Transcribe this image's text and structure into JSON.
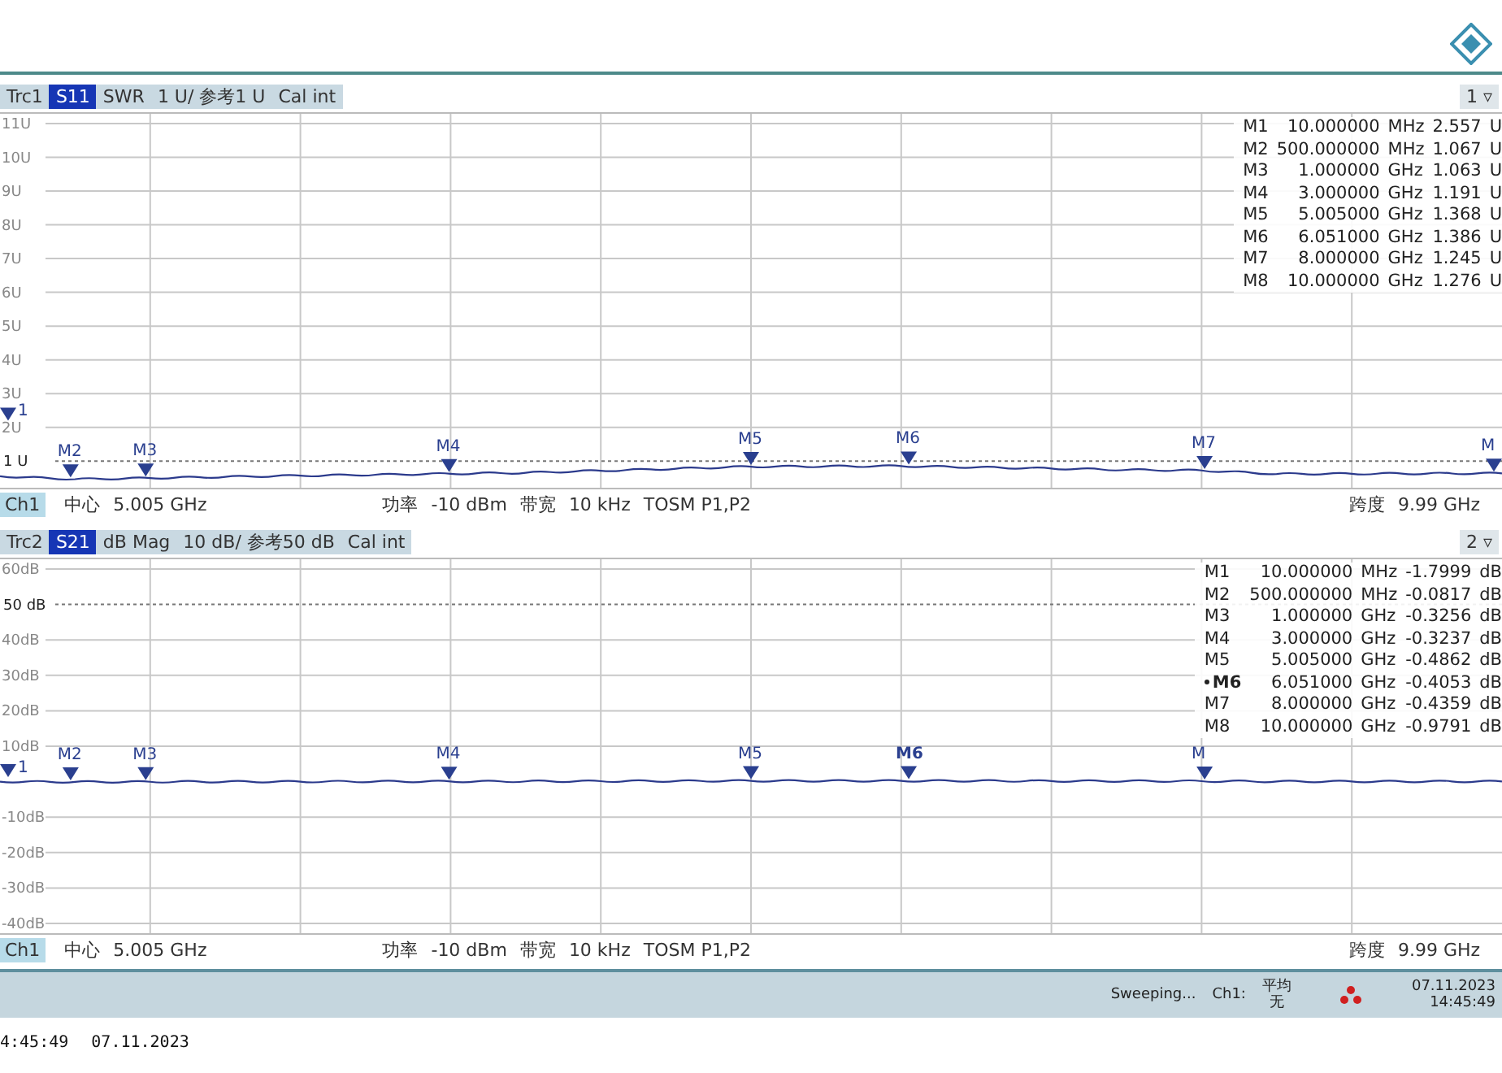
{
  "traces": [
    {
      "header": {
        "trace": "Trc1",
        "param": "S11",
        "format": "SWR",
        "scale": "1 U/ 参考1 U",
        "cal": "Cal int",
        "window": "1 ▿"
      },
      "y_axis": [
        {
          "label": "11U",
          "kind": "tick"
        },
        {
          "label": "10U",
          "kind": "tick"
        },
        {
          "label": "9U",
          "kind": "tick"
        },
        {
          "label": "8U",
          "kind": "tick"
        },
        {
          "label": "7U",
          "kind": "tick"
        },
        {
          "label": "6U",
          "kind": "tick"
        },
        {
          "label": "5U",
          "kind": "tick"
        },
        {
          "label": "4U",
          "kind": "tick"
        },
        {
          "label": "3U",
          "kind": "tick"
        },
        {
          "label": "2U",
          "kind": "tick"
        },
        {
          "label": "1 U",
          "kind": "reference"
        }
      ],
      "plot_markers": [
        {
          "label": "1",
          "selected": false
        },
        {
          "label": "M2",
          "selected": false
        },
        {
          "label": "M3",
          "selected": false
        },
        {
          "label": "M4",
          "selected": false
        },
        {
          "label": "M5",
          "selected": false
        },
        {
          "label": "M6",
          "selected": false
        },
        {
          "label": "M7",
          "selected": false
        },
        {
          "label": "M",
          "selected": false
        }
      ],
      "markers": [
        {
          "name": "M1",
          "freq": "10.000000",
          "unit": "MHz",
          "value": "2.557",
          "vunit": "U",
          "selected": false
        },
        {
          "name": "M2",
          "freq": "500.000000",
          "unit": "MHz",
          "value": "1.067",
          "vunit": "U",
          "selected": false
        },
        {
          "name": "M3",
          "freq": "1.000000",
          "unit": "GHz",
          "value": "1.063",
          "vunit": "U",
          "selected": false
        },
        {
          "name": "M4",
          "freq": "3.000000",
          "unit": "GHz",
          "value": "1.191",
          "vunit": "U",
          "selected": false
        },
        {
          "name": "M5",
          "freq": "5.005000",
          "unit": "GHz",
          "value": "1.368",
          "vunit": "U",
          "selected": false
        },
        {
          "name": "M6",
          "freq": "6.051000",
          "unit": "GHz",
          "value": "1.386",
          "vunit": "U",
          "selected": false
        },
        {
          "name": "M7",
          "freq": "8.000000",
          "unit": "GHz",
          "value": "1.245",
          "vunit": "U",
          "selected": false
        },
        {
          "name": "M8",
          "freq": "10.000000",
          "unit": "GHz",
          "value": "1.276",
          "vunit": "U",
          "selected": false
        }
      ],
      "channel": {
        "ch": "Ch1",
        "center_label": "中心",
        "center": "5.005 GHz",
        "power_label": "功率",
        "power": "-10 dBm",
        "bw_label": "带宽",
        "bw": "10 kHz",
        "cal": "TOSM P1,P2",
        "span_label": "跨度",
        "span": "9.99 GHz"
      }
    },
    {
      "header": {
        "trace": "Trc2",
        "param": "S21",
        "format": "dB Mag",
        "scale": "10 dB/ 参考50 dB",
        "cal": "Cal int",
        "window": "2 ▿"
      },
      "y_axis": [
        {
          "label": "60dB",
          "kind": "tick"
        },
        {
          "label": "50 dB",
          "kind": "reference"
        },
        {
          "label": "40dB",
          "kind": "tick"
        },
        {
          "label": "30dB",
          "kind": "tick"
        },
        {
          "label": "20dB",
          "kind": "tick"
        },
        {
          "label": "10dB",
          "kind": "tick"
        },
        {
          "label": "-10dB",
          "kind": "tick"
        },
        {
          "label": "-20dB",
          "kind": "tick"
        },
        {
          "label": "-30dB",
          "kind": "tick"
        },
        {
          "label": "-40dB",
          "kind": "tick"
        }
      ],
      "plot_markers": [
        {
          "label": "1",
          "selected": false
        },
        {
          "label": "M2",
          "selected": false
        },
        {
          "label": "M3",
          "selected": false
        },
        {
          "label": "M4",
          "selected": false
        },
        {
          "label": "M5",
          "selected": false
        },
        {
          "label": "M6",
          "selected": true
        },
        {
          "label": "M",
          "selected": false
        }
      ],
      "markers": [
        {
          "name": "M1",
          "freq": "10.000000",
          "unit": "MHz",
          "value": "-1.7999",
          "vunit": "dB",
          "selected": false
        },
        {
          "name": "M2",
          "freq": "500.000000",
          "unit": "MHz",
          "value": "-0.0817",
          "vunit": "dB",
          "selected": false
        },
        {
          "name": "M3",
          "freq": "1.000000",
          "unit": "GHz",
          "value": "-0.3256",
          "vunit": "dB",
          "selected": false
        },
        {
          "name": "M4",
          "freq": "3.000000",
          "unit": "GHz",
          "value": "-0.3237",
          "vunit": "dB",
          "selected": false
        },
        {
          "name": "M5",
          "freq": "5.005000",
          "unit": "GHz",
          "value": "-0.4862",
          "vunit": "dB",
          "selected": false
        },
        {
          "name": "M6",
          "freq": "6.051000",
          "unit": "GHz",
          "value": "-0.4053",
          "vunit": "dB",
          "selected": true
        },
        {
          "name": "M7",
          "freq": "8.000000",
          "unit": "GHz",
          "value": "-0.4359",
          "vunit": "dB",
          "selected": false
        },
        {
          "name": "M8",
          "freq": "10.000000",
          "unit": "GHz",
          "value": "-0.9791",
          "vunit": "dB",
          "selected": false
        }
      ],
      "channel": {
        "ch": "Ch1",
        "center_label": "中心",
        "center": "5.005 GHz",
        "power_label": "功率",
        "power": "-10 dBm",
        "bw_label": "带宽",
        "bw": "10 kHz",
        "cal": "TOSM P1,P2",
        "span_label": "跨度",
        "span": "9.99 GHz"
      }
    }
  ],
  "status_bar": {
    "state": "Sweeping...",
    "channel": "Ch1:",
    "avg_label": "平均",
    "avg": "无",
    "date": "07.11.2023",
    "time": "14:45:49"
  },
  "footer": {
    "time": "4:45:49",
    "date": "07.11.2023"
  }
}
